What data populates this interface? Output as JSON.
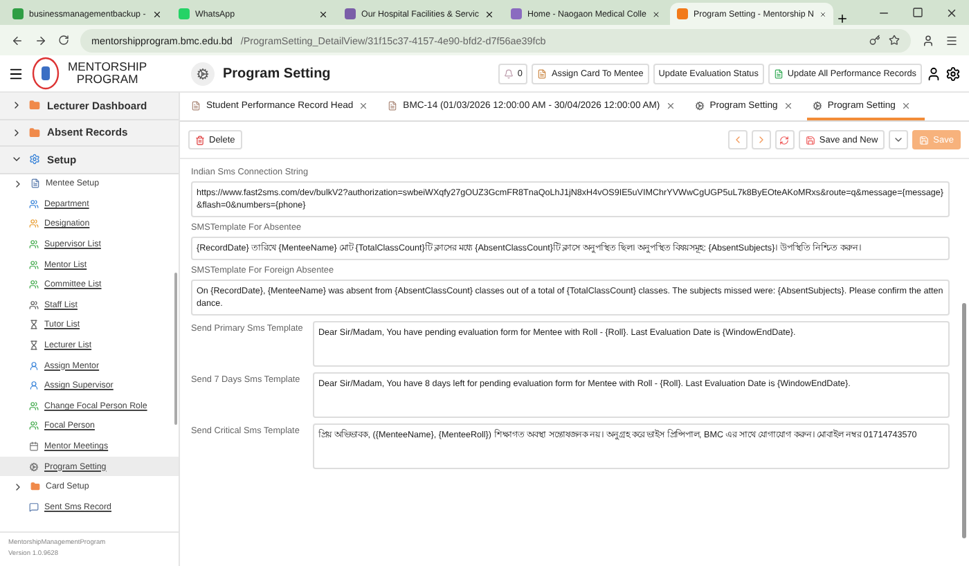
{
  "browser": {
    "tabs": [
      {
        "title": "businessmanagementbackup -",
        "selected": false
      },
      {
        "title": "WhatsApp",
        "selected": false
      },
      {
        "title": "Our Hospital Facilities & Servic",
        "selected": false
      },
      {
        "title": "Home - Naogaon Medical Colle",
        "selected": false
      },
      {
        "title": "Program Setting - Mentorship N",
        "selected": true
      }
    ],
    "url_host": "mentorshipprogram.bmc.edu.bd",
    "url_path": "/ProgramSetting_DetailView/31f15c37-4157-4e90-bfd2-d7f56ae39fcb"
  },
  "app": {
    "title_line_1": "MENTORSHIP",
    "title_line_2": "PROGRAM",
    "page_title": "Program Setting",
    "notification_count": "0",
    "actions": [
      "Assign Card To Mentee",
      "Update Evaluation Status",
      "Update All Performance Records"
    ]
  },
  "sidebar": {
    "groups": [
      {
        "label": "Lecturer Dashboard",
        "expanded": false
      },
      {
        "label": "Absent Records",
        "expanded": false
      },
      {
        "label": "Setup",
        "expanded": true,
        "children": [
          {
            "label": "Mentee Setup",
            "kind": "folder",
            "expanded": false,
            "selected": false
          },
          {
            "label": "Department",
            "kind": "link",
            "selected": false
          },
          {
            "label": "Designation",
            "kind": "link",
            "selected": false
          },
          {
            "label": "Supervisor List",
            "kind": "link",
            "selected": false
          },
          {
            "label": "Mentor List",
            "kind": "link",
            "selected": false
          },
          {
            "label": "Committee List",
            "kind": "link",
            "selected": false
          },
          {
            "label": "Staff List",
            "kind": "link",
            "selected": false
          },
          {
            "label": "Tutor List",
            "kind": "link",
            "selected": false
          },
          {
            "label": "Lecturer List",
            "kind": "link",
            "selected": false
          },
          {
            "label": "Assign Mentor",
            "kind": "link",
            "selected": false
          },
          {
            "label": "Assign Supervisor",
            "kind": "link",
            "selected": false
          },
          {
            "label": "Change Focal Person Role",
            "kind": "link",
            "selected": false
          },
          {
            "label": "Focal Person",
            "kind": "link",
            "selected": false
          },
          {
            "label": "Mentor Meetings",
            "kind": "link",
            "selected": false
          },
          {
            "label": "Program Setting",
            "kind": "link",
            "selected": true
          },
          {
            "label": "Card Setup",
            "kind": "folder",
            "expanded": false,
            "selected": false
          },
          {
            "label": "Sent Sms Record",
            "kind": "link",
            "selected": false
          }
        ]
      }
    ],
    "footer_name": "MentorshipManagementProgram",
    "footer_version": "Version 1.0.9628"
  },
  "doc_tabs": [
    {
      "title": "Student Performance Record Head",
      "selected": false
    },
    {
      "title": "BMC-14 (01/03/2026 12:00:00 AM - 30/04/2026 12:00:00 AM)",
      "selected": false
    },
    {
      "title": "Program Setting",
      "selected": false
    },
    {
      "title": "Program Setting",
      "selected": true
    }
  ],
  "toolbar": {
    "delete": "Delete",
    "save_and_new": "Save and New",
    "save": "Save"
  },
  "fields": [
    {
      "label": "Indian Sms Connection String",
      "kind": "stacked",
      "value": "https://www.fast2sms.com/dev/bulkV2?authorization=swbeiWXqfy27gOUZ3GcmFR8TnaQoLhJ1jN8xH4vOS9IE5uVIMChrYVWwCgUGP5uL7k8ByEOteAKoMRxs&route=q&message={message}&flash=0&numbers={phone}"
    },
    {
      "label": "SMSTemplate For Absentee",
      "kind": "stacked",
      "value": "{RecordDate} তারিখে {MenteeName} মোট {TotalClassCount}টি ক্লাসের মধ্যে {AbsentClassCount}টি ক্লাসে অনুপস্থিত ছিল। অনুপস্থিত বিষয়সমূহ: {AbsentSubjects}। উপস্থিতি নিশ্চিত করুন।"
    },
    {
      "label": "SMSTemplate For Foreign Absentee",
      "kind": "stacked",
      "value": "On {RecordDate}, {MenteeName} was absent from {AbsentClassCount} classes out of a total of {TotalClassCount} classes. The subjects missed were: {AbsentSubjects}. Please confirm the attendance."
    },
    {
      "label": "Send Primary Sms Template",
      "kind": "inline",
      "value": "Dear Sir/Madam, You have pending evaluation form for Mentee with Roll - {Roll}. Last Evaluation Date is {WindowEndDate}."
    },
    {
      "label": "Send 7 Days Sms Template",
      "kind": "inline",
      "value": "Dear Sir/Madam, You have 8 days left for pending evaluation form for Mentee with Roll - {Roll}. Last Evaluation Date is {WindowEndDate}."
    },
    {
      "label": "Send Critical Sms Template",
      "kind": "inline",
      "value": "প্রিয় অভিভাবক, ({MenteeName}, {MenteeRoll}) শিক্ষাগত অবস্থা সন্তোষজনক নয়। অনুগ্রহ করে ভাইস প্রিন্সিপাল, BMC এর সাথে যোগাযোগ করুন। মোবাইল নম্বর 01714743570"
    }
  ]
}
